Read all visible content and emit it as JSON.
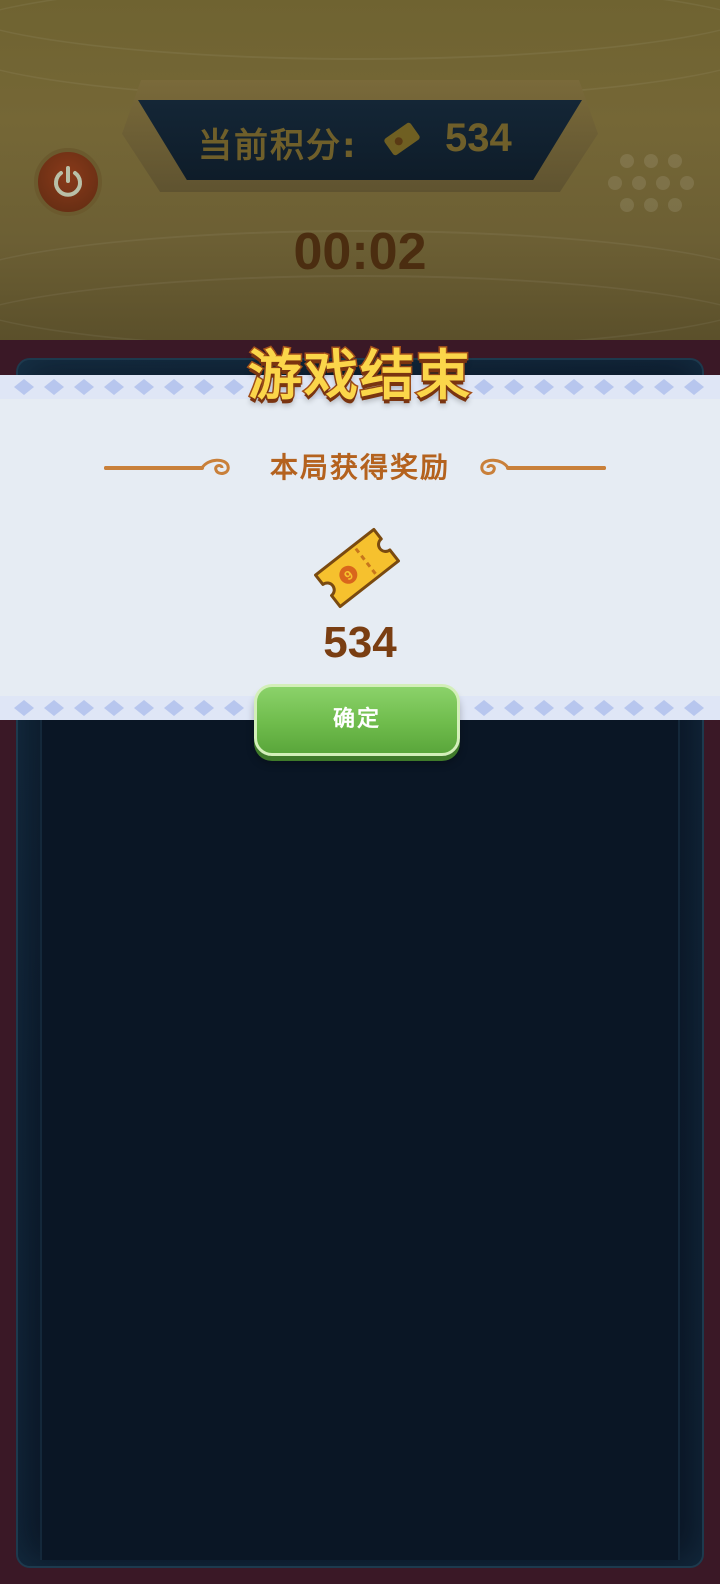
{
  "header": {
    "score_label": "当前积分:",
    "score_value": "534",
    "timer": "00:02"
  },
  "modal": {
    "title": "游戏结束",
    "reward_title": "本局获得奖励",
    "reward_value": "534",
    "confirm_label": "确定"
  },
  "icons": {
    "power": "power-icon",
    "ticket": "ticket-icon",
    "dots": "dots-pad-icon"
  },
  "colors": {
    "title_fill": "#fbd64a",
    "title_stroke": "#a6511a",
    "reward_text": "#b4621e",
    "confirm_green": "#6fbc4c",
    "modal_bg": "#e6ecf3"
  }
}
